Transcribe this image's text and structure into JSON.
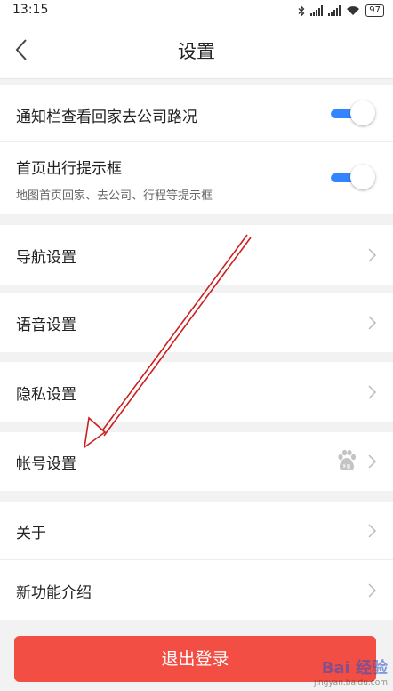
{
  "status_bar": {
    "time": "13:15",
    "battery": "97",
    "icons": [
      "bluetooth-icon",
      "signal-icon",
      "signal-icon",
      "wifi-icon",
      "battery-icon"
    ]
  },
  "header": {
    "back_icon": "chevron-left-icon",
    "title": "设置"
  },
  "toggles": [
    {
      "label": "通知栏查看回家去公司路况",
      "on": true
    },
    {
      "label": "首页出行提示框",
      "subtitle": "地图首页回家、去公司、行程等提示框",
      "on": true
    }
  ],
  "menu": {
    "navigation": "导航设置",
    "voice": "语音设置",
    "privacy": "隐私设置",
    "account": "帐号设置",
    "account_icon": "baidu-paw-icon",
    "about": "关于",
    "new_features": "新功能介绍"
  },
  "logout_button": "退出登录",
  "watermark": {
    "logo": "Bai 经验",
    "url": "jingyan.baidu.com"
  },
  "colors": {
    "accent_blue": "#3385ff",
    "logout_red": "#f24e44",
    "arrow_red": "#cc1f1f",
    "separator": "#f2f2f2"
  }
}
